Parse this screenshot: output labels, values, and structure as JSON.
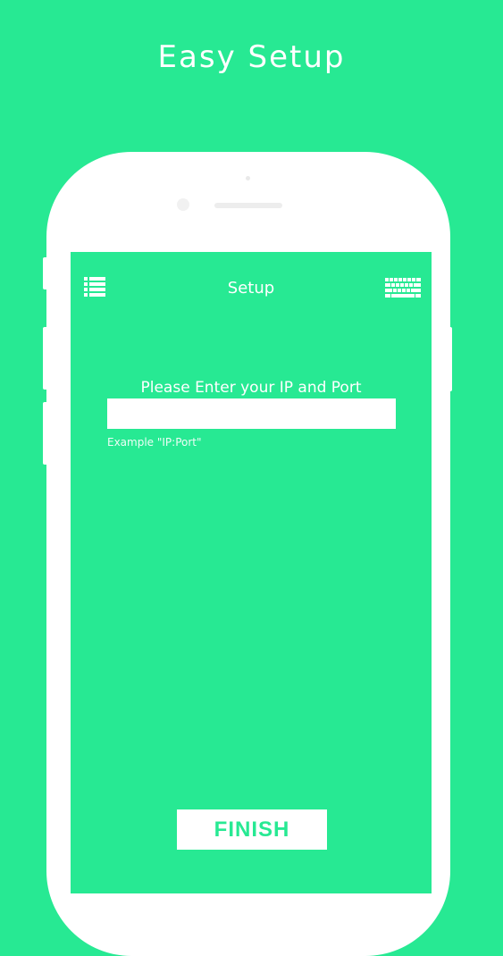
{
  "banner": {
    "title": "Easy Setup"
  },
  "navbar": {
    "title": "Setup",
    "left_icon": "list-menu-icon",
    "right_icon": "keyboard-icon"
  },
  "form": {
    "prompt": "Please Enter your IP and Port",
    "input_value": "",
    "hint": "Example \"IP:Port\""
  },
  "actions": {
    "finish_label": "FINISH"
  },
  "colors": {
    "accent": "#27e993",
    "surface": "#ffffff"
  }
}
